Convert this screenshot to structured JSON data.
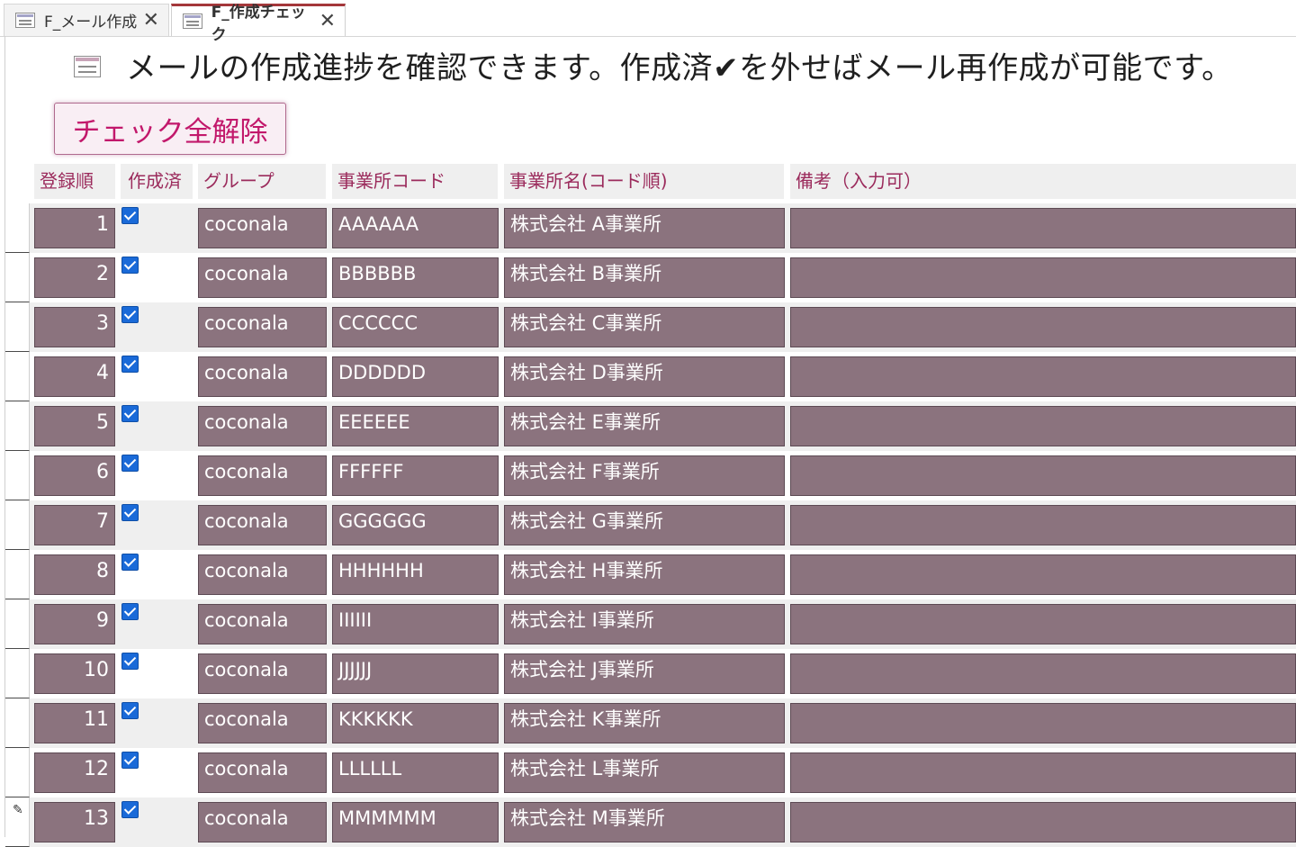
{
  "tabs": [
    {
      "label": "F_メール作成",
      "active": false
    },
    {
      "label": "F_作成チェック",
      "active": true
    }
  ],
  "header": {
    "instruction": "メールの作成進捗を確認できます。作成済✔を外せばメール再作成が可能です。",
    "uncheck_all_label": "チェック全解除"
  },
  "columns": {
    "order": "登録順",
    "created": "作成済",
    "group": "グループ",
    "office_code": "事業所コード",
    "office_name": "事業所名(コード順)",
    "remarks": "備考（入力可）"
  },
  "colors": {
    "cell_fill": "#8b737e",
    "header_text": "#9b2b5c",
    "button_text": "#c2186b",
    "checkbox": "#1a6ad8",
    "active_tab_accent": "#a4373a"
  },
  "rows": [
    {
      "order": "1",
      "created": true,
      "group": "coconala",
      "code": "AAAAAA",
      "name": "株式会社 A事業所",
      "remarks": ""
    },
    {
      "order": "2",
      "created": true,
      "group": "coconala",
      "code": "BBBBBB",
      "name": "株式会社 B事業所",
      "remarks": ""
    },
    {
      "order": "3",
      "created": true,
      "group": "coconala",
      "code": "CCCCCC",
      "name": "株式会社 C事業所",
      "remarks": ""
    },
    {
      "order": "4",
      "created": true,
      "group": "coconala",
      "code": "DDDDDD",
      "name": "株式会社 D事業所",
      "remarks": ""
    },
    {
      "order": "5",
      "created": true,
      "group": "coconala",
      "code": "EEEEEE",
      "name": "株式会社 E事業所",
      "remarks": ""
    },
    {
      "order": "6",
      "created": true,
      "group": "coconala",
      "code": "FFFFFF",
      "name": "株式会社 F事業所",
      "remarks": ""
    },
    {
      "order": "7",
      "created": true,
      "group": "coconala",
      "code": "GGGGGG",
      "name": "株式会社 G事業所",
      "remarks": ""
    },
    {
      "order": "8",
      "created": true,
      "group": "coconala",
      "code": "HHHHHH",
      "name": "株式会社 H事業所",
      "remarks": ""
    },
    {
      "order": "9",
      "created": true,
      "group": "coconala",
      "code": "IIIIII",
      "name": "株式会社 I事業所",
      "remarks": ""
    },
    {
      "order": "10",
      "created": true,
      "group": "coconala",
      "code": "JJJJJJ",
      "name": "株式会社 J事業所",
      "remarks": ""
    },
    {
      "order": "11",
      "created": true,
      "group": "coconala",
      "code": "KKKKKK",
      "name": "株式会社 K事業所",
      "remarks": ""
    },
    {
      "order": "12",
      "created": true,
      "group": "coconala",
      "code": "LLLLLL",
      "name": "株式会社 L事業所",
      "remarks": ""
    },
    {
      "order": "13",
      "created": true,
      "group": "coconala",
      "code": "MMMMMM",
      "name": "株式会社 M事業所",
      "remarks": ""
    }
  ]
}
